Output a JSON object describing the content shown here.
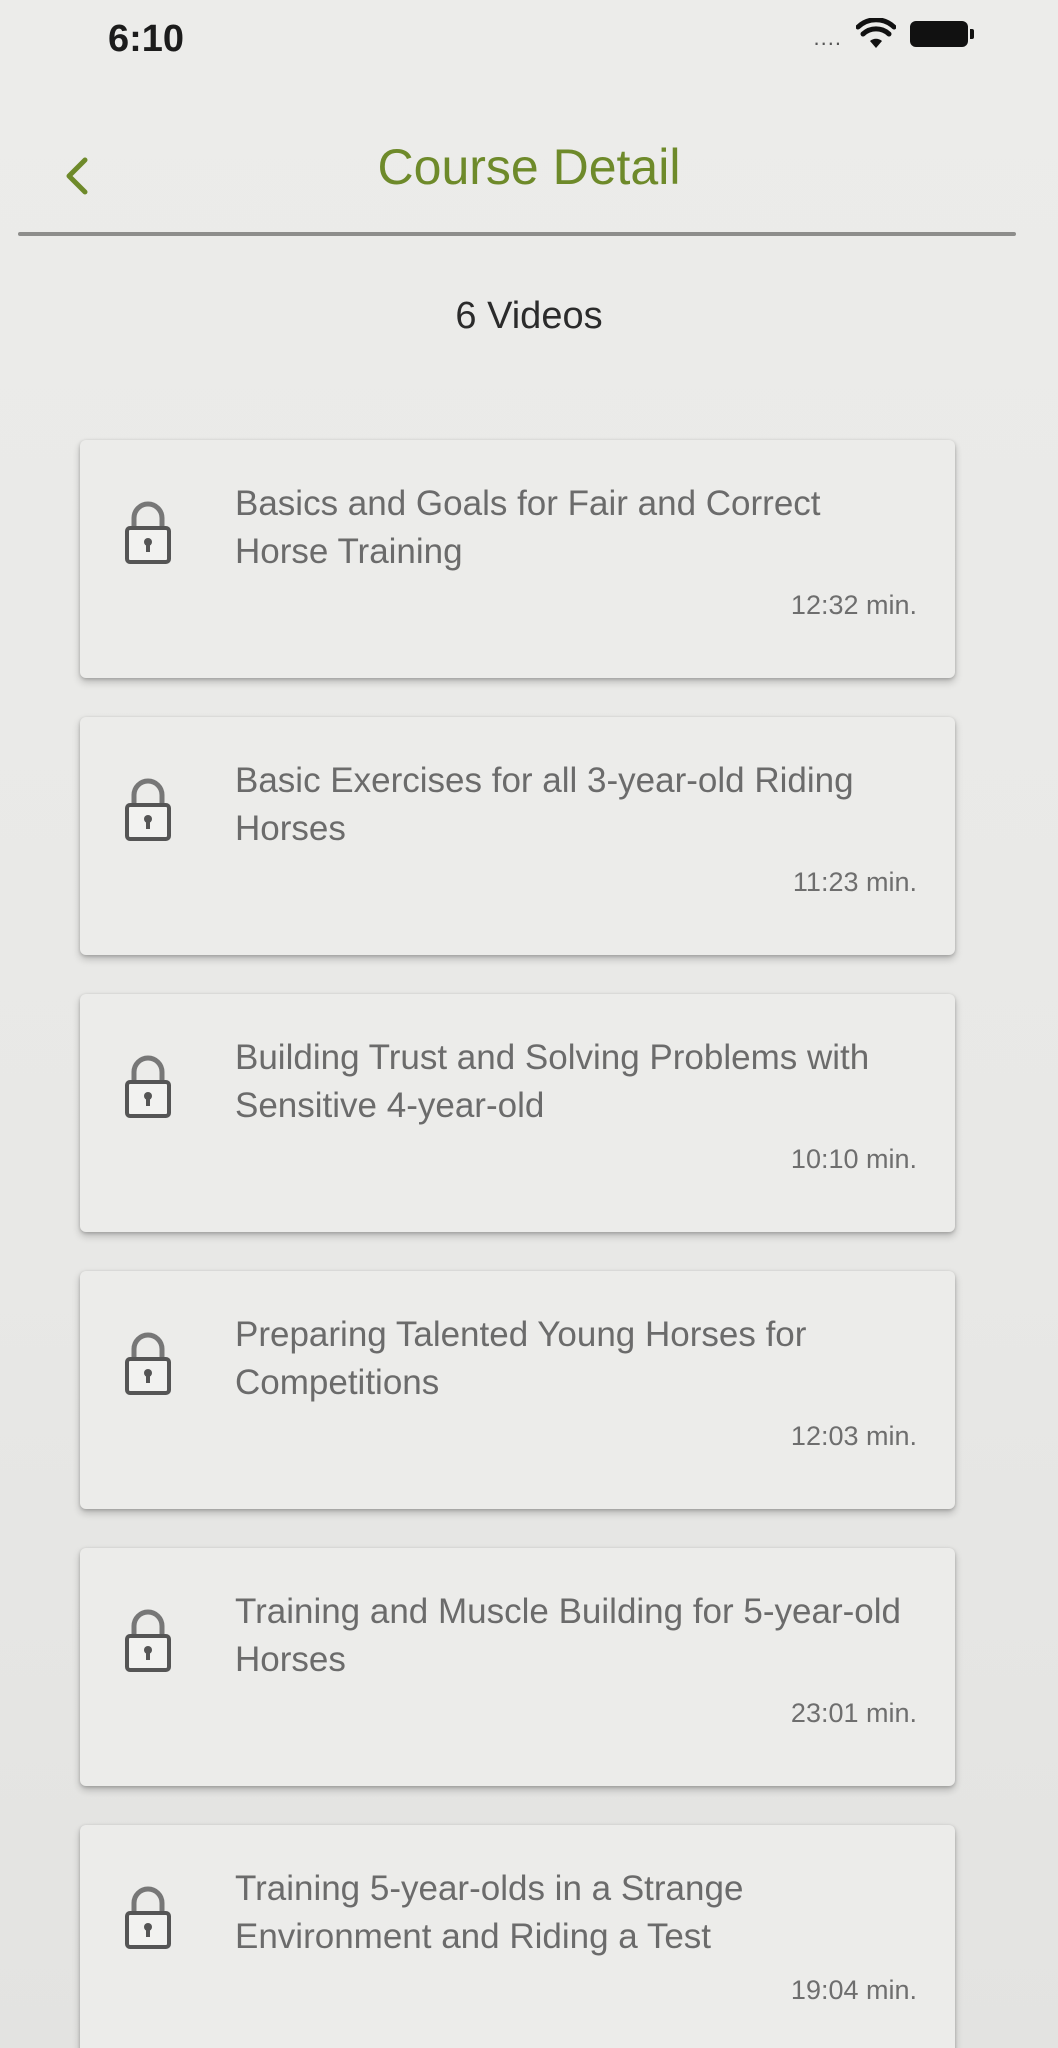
{
  "status_bar": {
    "time": "6:10",
    "signal": "....",
    "wifi_icon": "wifi-icon",
    "battery_icon": "battery-icon"
  },
  "nav": {
    "title": "Course Detail",
    "back_icon": "chevron-left-icon"
  },
  "summary": {
    "video_count_label": "6 Videos"
  },
  "colors": {
    "title_green": "#6e8a2a",
    "background": "#e9e9e7",
    "card": "#ececea",
    "text_gray": "#6b6b6b"
  },
  "videos": [
    {
      "title": "Basics and Goals for Fair and Correct Horse Training",
      "duration": "12:32 min.",
      "locked": true,
      "icon": "lock-icon"
    },
    {
      "title": "Basic Exercises for all 3-year-old Riding Horses",
      "duration": "11:23 min.",
      "locked": true,
      "icon": "lock-icon"
    },
    {
      "title": "Building Trust and Solving Problems with Sensitive 4-year-old",
      "duration": "10:10 min.",
      "locked": true,
      "icon": "lock-icon"
    },
    {
      "title": "Preparing Talented Young Horses for Competitions",
      "duration": "12:03 min.",
      "locked": true,
      "icon": "lock-icon"
    },
    {
      "title": "Training and Muscle Building for 5-year-old Horses",
      "duration": "23:01 min.",
      "locked": true,
      "icon": "lock-icon"
    },
    {
      "title": "Training 5-year-olds in a Strange Environment and Riding a Test",
      "duration": "19:04 min.",
      "locked": true,
      "icon": "lock-icon"
    }
  ]
}
